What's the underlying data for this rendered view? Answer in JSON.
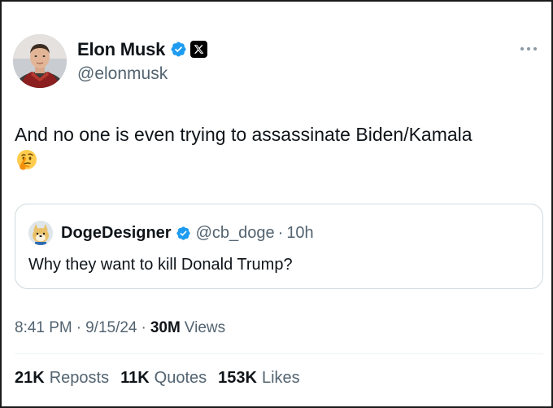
{
  "author": {
    "display_name": "Elon Musk",
    "handle": "@elonmusk"
  },
  "tweet": {
    "text": "And no one is even trying to assassinate Biden/Kamala",
    "emoji": "thinking-face-icon"
  },
  "quoted": {
    "display_name": "DogeDesigner",
    "handle": "@cb_doge",
    "separator": "·",
    "time": "10h",
    "text": "Why they want to kill Donald Trump?"
  },
  "meta": {
    "time": "8:41 PM",
    "sep1": "·",
    "date": "9/15/24",
    "sep2": "·",
    "views_count": "30M",
    "views_label": "Views"
  },
  "stats": [
    {
      "count": "21K",
      "label": "Reposts"
    },
    {
      "count": "11K",
      "label": "Quotes"
    },
    {
      "count": "153K",
      "label": "Likes"
    }
  ],
  "colors": {
    "text_primary": "#0f1419",
    "text_secondary": "#536471",
    "verified_blue": "#1d9bf0",
    "border": "#cfd9de"
  }
}
